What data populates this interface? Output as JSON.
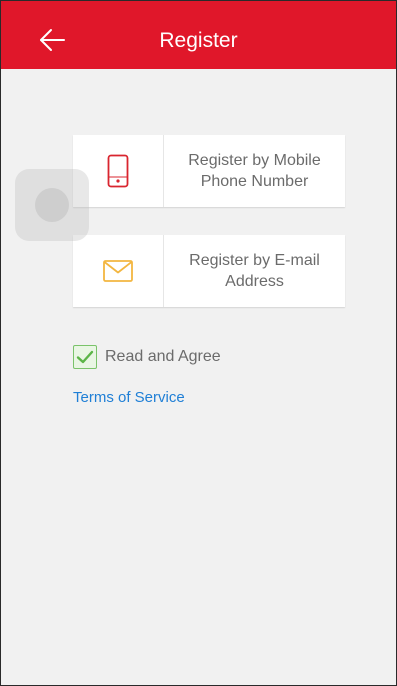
{
  "header": {
    "title": "Register",
    "back_icon": "arrow-left-icon"
  },
  "options": [
    {
      "label": "Register by Mobile Phone Number",
      "icon": "mobile-phone-icon",
      "icon_color": "#d9252f"
    },
    {
      "label": "Register by E-mail Address",
      "icon": "envelope-icon",
      "icon_color": "#f3b640"
    }
  ],
  "agreement": {
    "checked": true,
    "label": "Read and Agree",
    "terms_link": "Terms of Service"
  },
  "colors": {
    "brand": "#e0172a",
    "link": "#1f7fd6",
    "check": "#7ac36a"
  }
}
